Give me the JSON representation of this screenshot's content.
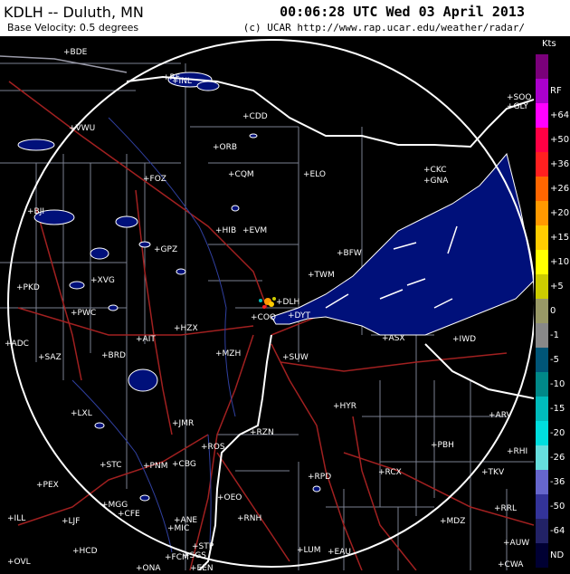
{
  "header": {
    "station_title": "KDLH -- Duluth, MN",
    "timestamp": "00:06:28 UTC Wed 03 April 2013",
    "product_name": "Base Velocity: 0.5 degrees",
    "credit": "(c) UCAR  http://www.rap.ucar.edu/weather/radar/"
  },
  "legend": {
    "unit": "Kts",
    "items": [
      {
        "label": "",
        "color": "#7a007a"
      },
      {
        "label": "RF",
        "color": "#aa00cc"
      },
      {
        "label": "+64",
        "color": "#ff00ff"
      },
      {
        "label": "+50",
        "color": "#ff0044"
      },
      {
        "label": "+36",
        "color": "#ff2020"
      },
      {
        "label": "+26",
        "color": "#ff6600"
      },
      {
        "label": "+20",
        "color": "#ff9900"
      },
      {
        "label": "+15",
        "color": "#ffcc00"
      },
      {
        "label": "+10",
        "color": "#ffff00"
      },
      {
        "label": "+5",
        "color": "#cccc00"
      },
      {
        "label": "0",
        "color": "#999966"
      },
      {
        "label": "-1",
        "color": "#888888"
      },
      {
        "label": "-5",
        "color": "#005577"
      },
      {
        "label": "-10",
        "color": "#008888"
      },
      {
        "label": "-15",
        "color": "#00bbbb"
      },
      {
        "label": "-20",
        "color": "#00dddd"
      },
      {
        "label": "-26",
        "color": "#66dddd"
      },
      {
        "label": "-36",
        "color": "#6666cc"
      },
      {
        "label": "-50",
        "color": "#333399"
      },
      {
        "label": "-64",
        "color": "#222266"
      },
      {
        "label": "ND",
        "color": "#000033"
      }
    ]
  },
  "colors": {
    "lake": "#00107a",
    "lake_edge": "#ffffff",
    "county_lines": "#7a8090",
    "roads": "#a12020",
    "state_border": "#ffffff",
    "range_ring": "#ffffff",
    "labels": "#ffffff"
  },
  "stations": [
    {
      "code": "RF"
    },
    {
      "code": "INL"
    },
    {
      "code": "CDD"
    },
    {
      "code": "FOZ"
    },
    {
      "code": "CQM"
    },
    {
      "code": "ORB"
    },
    {
      "code": "ELO"
    },
    {
      "code": "HIB"
    },
    {
      "code": "EVM"
    },
    {
      "code": "GPZ"
    },
    {
      "code": "BFW"
    },
    {
      "code": "TWM"
    },
    {
      "code": "DLH"
    },
    {
      "code": "DYT"
    },
    {
      "code": "COQ"
    },
    {
      "code": "HZX"
    },
    {
      "code": "AIT"
    },
    {
      "code": "BRD"
    },
    {
      "code": "MZH"
    },
    {
      "code": "SUW"
    },
    {
      "code": "ASX"
    },
    {
      "code": "IWD"
    },
    {
      "code": "PBH"
    },
    {
      "code": "RCX"
    },
    {
      "code": "RPD"
    },
    {
      "code": "HYR"
    },
    {
      "code": "RZN"
    },
    {
      "code": "JMR"
    },
    {
      "code": "ROS"
    },
    {
      "code": "CBG"
    },
    {
      "code": "PNM"
    },
    {
      "code": "STC"
    },
    {
      "code": "LXL"
    },
    {
      "code": "OEO"
    },
    {
      "code": "RNH"
    },
    {
      "code": "CFE"
    },
    {
      "code": "MGG"
    },
    {
      "code": "ANE"
    },
    {
      "code": "MIC"
    },
    {
      "code": "STP"
    },
    {
      "code": "LUM"
    },
    {
      "code": "EAU"
    },
    {
      "code": "MDZ"
    },
    {
      "code": "RRL"
    },
    {
      "code": "AUW"
    },
    {
      "code": "CWA"
    },
    {
      "code": "TKV"
    },
    {
      "code": "ARV"
    },
    {
      "code": "RHI"
    },
    {
      "code": "PKD"
    },
    {
      "code": "XVG"
    },
    {
      "code": "PWC"
    },
    {
      "code": "BJI"
    },
    {
      "code": "VWU"
    },
    {
      "code": "BDE"
    },
    {
      "code": "ADC"
    },
    {
      "code": "SAZ"
    },
    {
      "code": "PEX"
    },
    {
      "code": "ILL"
    },
    {
      "code": "LJF"
    },
    {
      "code": "HCD"
    },
    {
      "code": "OVL"
    },
    {
      "code": "FCM"
    },
    {
      "code": "SGS"
    },
    {
      "code": "CKC"
    },
    {
      "code": "GNA"
    },
    {
      "code": "SOO"
    },
    {
      "code": "GLY"
    },
    {
      "code": "ONA"
    },
    {
      "code": "EEN"
    }
  ]
}
